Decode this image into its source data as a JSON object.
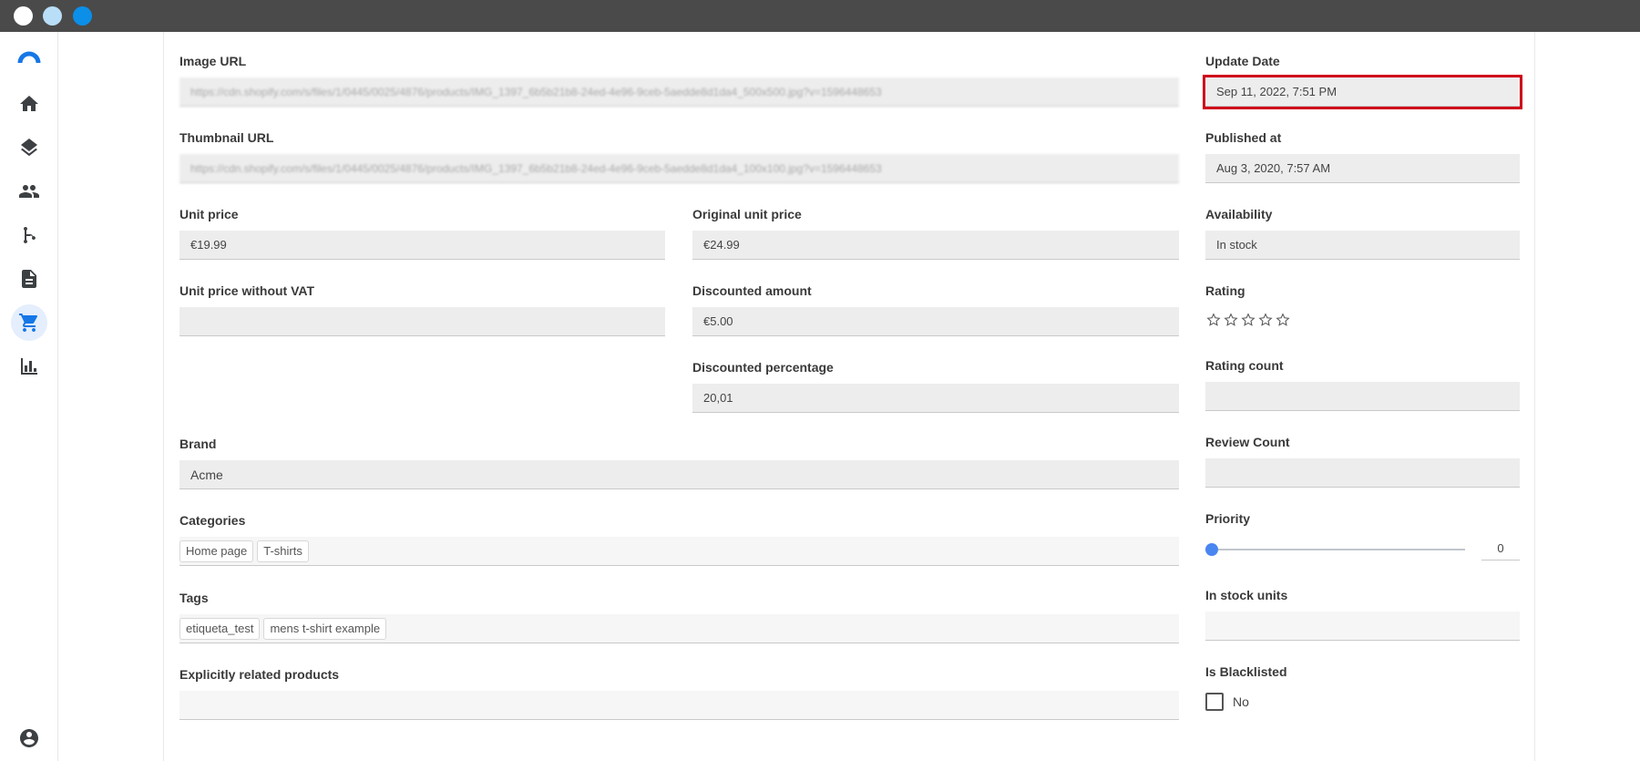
{
  "window": {
    "controls": [
      {
        "name": "close",
        "color": "#ffffff"
      },
      {
        "name": "minimize",
        "color": "#b9def7"
      },
      {
        "name": "maximize",
        "color": "#0b8fe8"
      }
    ]
  },
  "sidebar": {
    "items": [
      {
        "icon": "app-logo-icon"
      },
      {
        "icon": "home-icon"
      },
      {
        "icon": "layers-icon"
      },
      {
        "icon": "users-icon"
      },
      {
        "icon": "branch-icon"
      },
      {
        "icon": "document-icon"
      },
      {
        "icon": "cart-icon",
        "active": true
      },
      {
        "icon": "bar-chart-icon"
      },
      {
        "icon": "account-icon"
      }
    ]
  },
  "form": {
    "image_url": {
      "label": "Image URL",
      "value": "https://cdn.shopify.com/s/files/1/0445/0025/4876/products/IMG_1397_6b5b21b8-24ed-4e96-9ceb-5aedde8d1da4_500x500.jpg?v=1596448653"
    },
    "thumbnail_url": {
      "label": "Thumbnail URL",
      "value": "https://cdn.shopify.com/s/files/1/0445/0025/4876/products/IMG_1397_6b5b21b8-24ed-4e96-9ceb-5aedde8d1da4_100x100.jpg?v=1596448653"
    },
    "unit_price": {
      "label": "Unit price",
      "value": "€19.99"
    },
    "original_unit_price": {
      "label": "Original unit price",
      "value": "€24.99"
    },
    "unit_price_without_vat": {
      "label": "Unit price without VAT",
      "value": ""
    },
    "discounted_amount": {
      "label": "Discounted amount",
      "value": "€5.00"
    },
    "discounted_percentage": {
      "label": "Discounted percentage",
      "value": "20,01"
    },
    "brand": {
      "label": "Brand",
      "value": "Acme"
    },
    "categories": {
      "label": "Categories",
      "chips": [
        "Home page",
        "T-shirts"
      ]
    },
    "tags": {
      "label": "Tags",
      "chips": [
        "etiqueta_test",
        "mens t-shirt example"
      ]
    },
    "related_products": {
      "label": "Explicitly related products",
      "value": ""
    },
    "update_date": {
      "label": "Update Date",
      "value": "Sep 11, 2022, 7:51 PM"
    },
    "published_at": {
      "label": "Published at",
      "value": "Aug 3, 2020, 7:57 AM"
    },
    "availability": {
      "label": "Availability",
      "value": "In stock"
    },
    "rating": {
      "label": "Rating",
      "value": 0,
      "max": 5
    },
    "rating_count": {
      "label": "Rating count",
      "value": ""
    },
    "review_count": {
      "label": "Review Count",
      "value": ""
    },
    "priority": {
      "label": "Priority",
      "value": "0",
      "fraction": 0
    },
    "in_stock_units": {
      "label": "In stock units",
      "value": ""
    },
    "is_blacklisted": {
      "label": "Is Blacklisted",
      "value": "No",
      "checked": false
    }
  },
  "colors": {
    "accent": "#1677e6",
    "highlight": "#d0021b",
    "titlebar": "#4a4a4a"
  }
}
